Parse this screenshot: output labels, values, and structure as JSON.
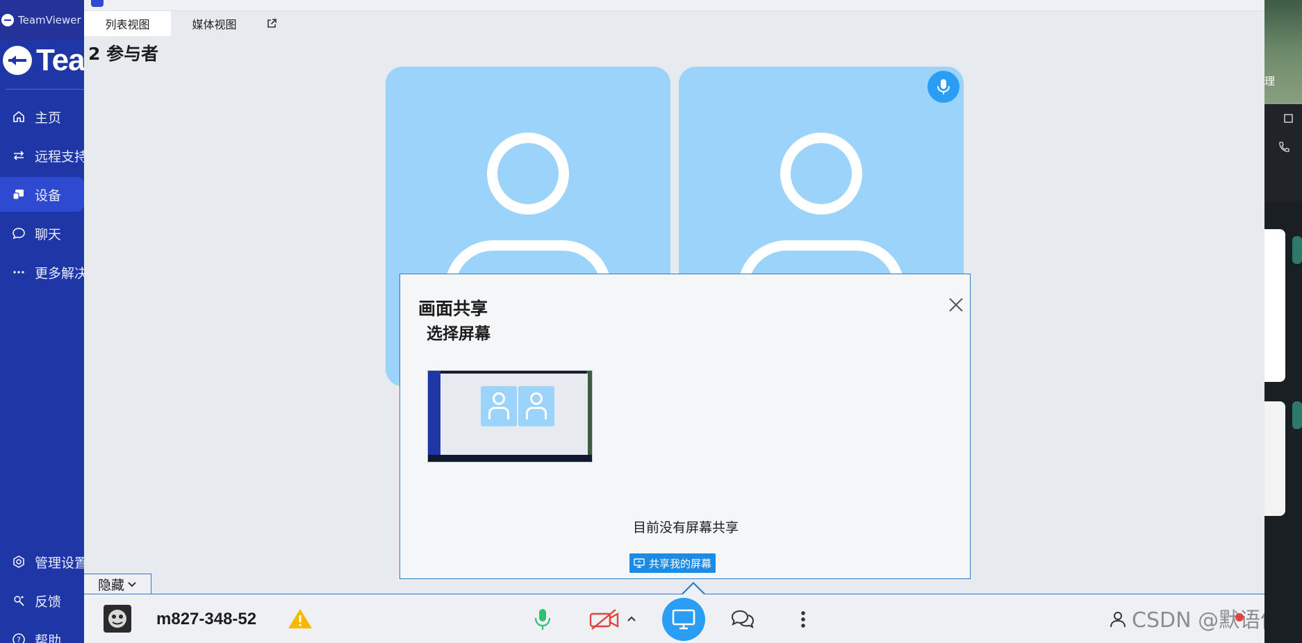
{
  "teamviewer": {
    "window_title": "TeamViewer",
    "brand": "Tea",
    "nav": [
      {
        "label": "主页",
        "icon": "home-icon"
      },
      {
        "label": "远程支持",
        "icon": "arrows-swap-icon"
      },
      {
        "label": "设备",
        "icon": "devices-icon"
      },
      {
        "label": "聊天",
        "icon": "chat-icon"
      },
      {
        "label": "更多解决",
        "icon": "more-dots-icon"
      }
    ],
    "bottom_nav": [
      {
        "label": "管理设置",
        "icon": "settings-icon"
      },
      {
        "label": "反馈",
        "icon": "feedback-icon"
      },
      {
        "label": "帮助",
        "icon": "help-icon"
      }
    ]
  },
  "background_right": {
    "text": "理"
  },
  "meeting": {
    "tabs": [
      {
        "label": "列表视图",
        "active": true
      },
      {
        "label": "媒体视图",
        "active": false
      }
    ],
    "participants_count": "2 参与者",
    "share_dialog": {
      "title": "画面共享",
      "subtitle": "选择屏幕",
      "no_share_text": "目前没有屏幕共享",
      "share_button": "共享我的屏幕"
    },
    "hide_label": "隐藏",
    "meeting_id": "m827-348-52",
    "watermark": "CSDN @默语佬"
  },
  "colors": {
    "sidebar": "#1f37a6",
    "accent": "#2a9df4",
    "card": "#9bd3fb",
    "mic_green": "#2fbf71",
    "camera_off": "#e0443c",
    "warning": "#f6b900"
  }
}
